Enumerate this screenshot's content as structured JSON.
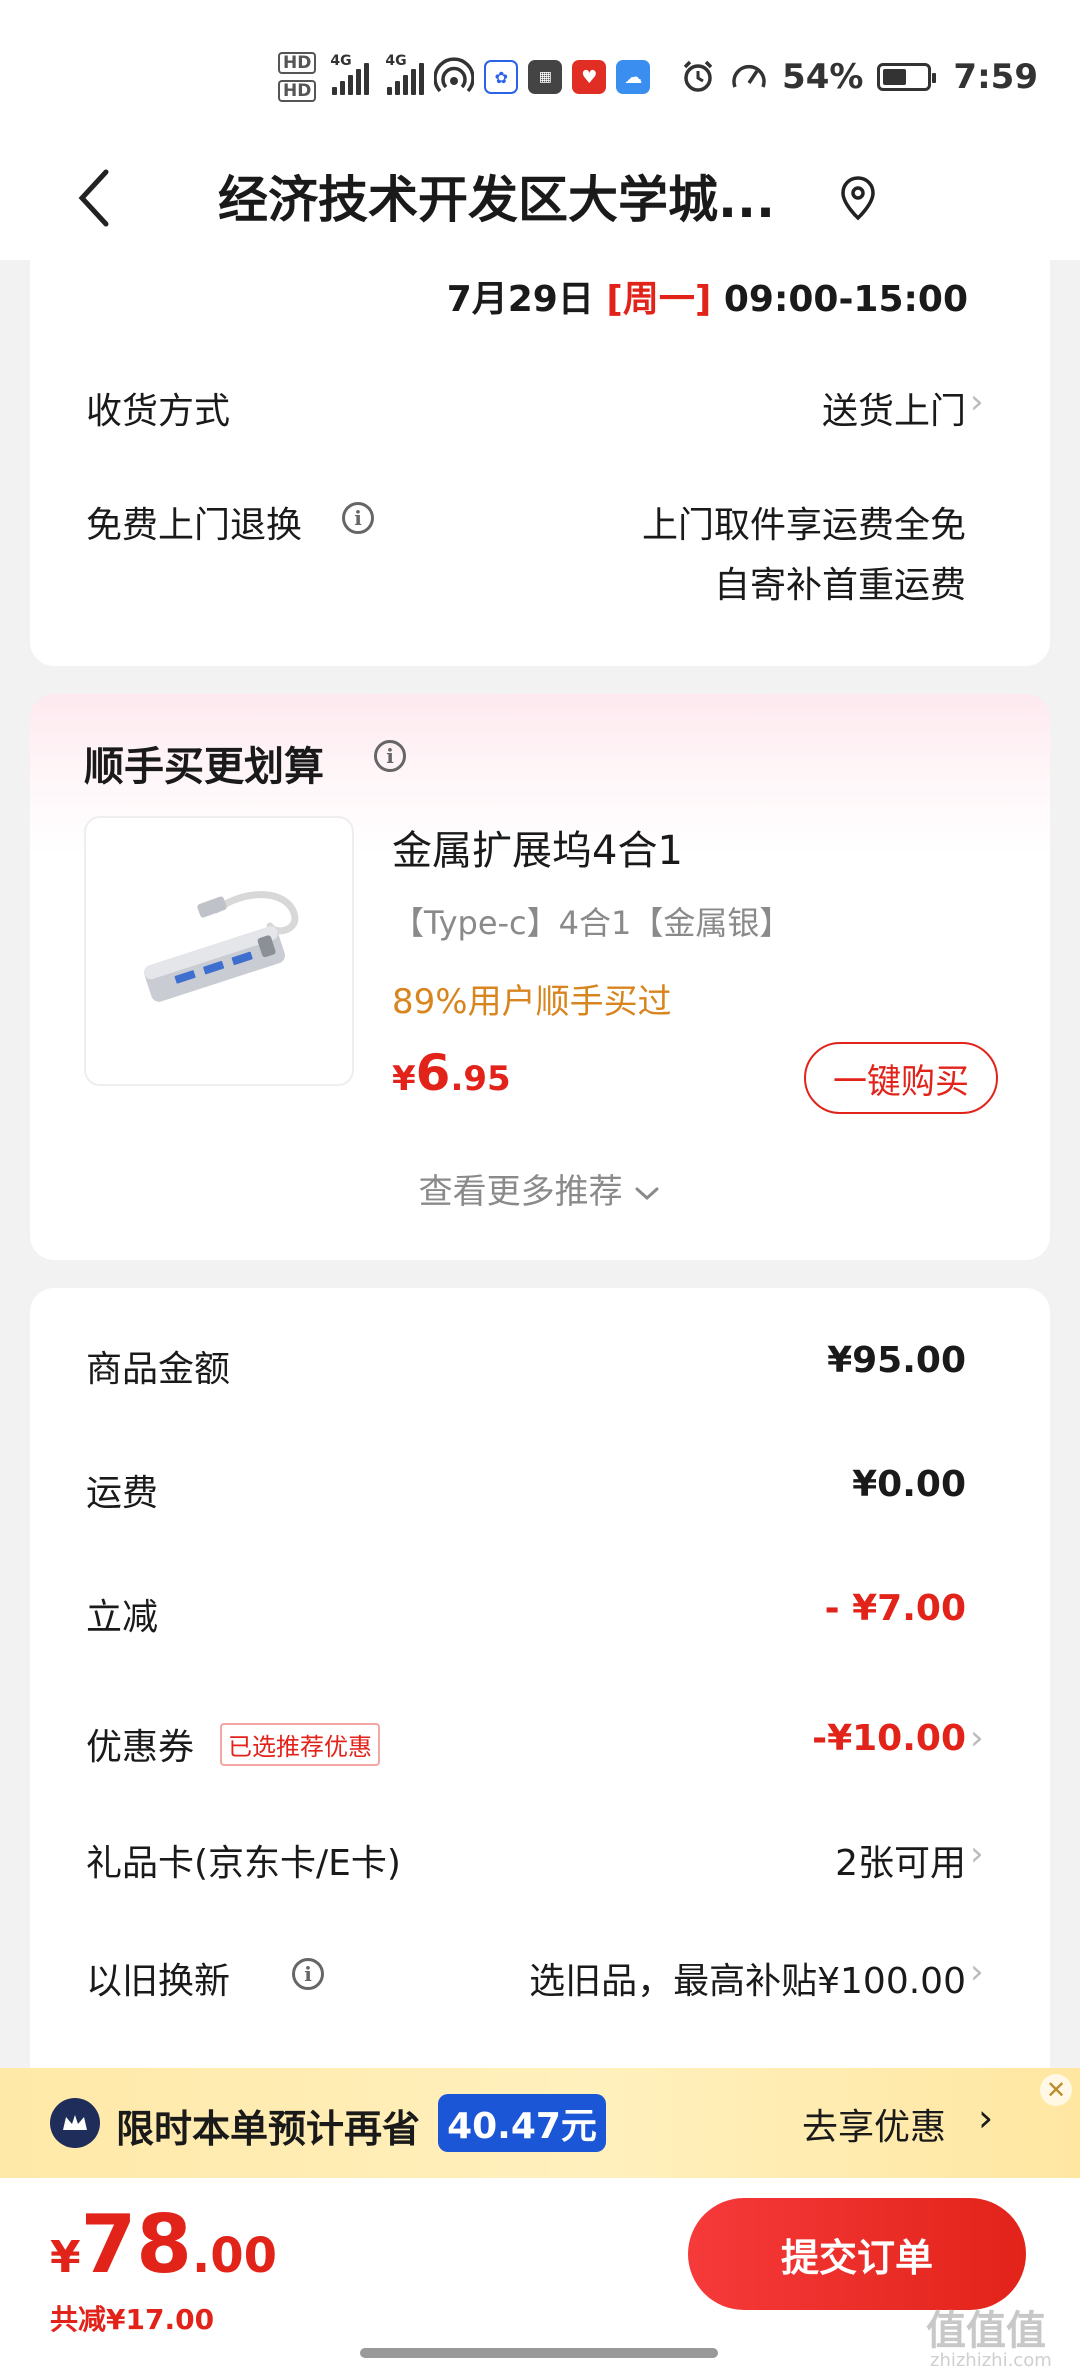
{
  "status_bar": {
    "hd1": "HD",
    "hd2": "HD",
    "net1": "4G",
    "net2": "4G",
    "battery": "54%",
    "time": "7:59"
  },
  "nav": {
    "title": "经济技术开发区大学城..."
  },
  "delivery": {
    "date": "7月29日",
    "weekday": "[周一]",
    "time_range": "09:00-15:00",
    "method_label": "收货方式",
    "method_value": "送货上门",
    "return_label": "免费上门退换",
    "return_line1": "上门取件享运费全免",
    "return_line2": "自寄补首重运费"
  },
  "recommend": {
    "title": "顺手买更划算",
    "product_name": "金属扩展坞4合1",
    "product_spec": "【Type-c】4合1【金属银】",
    "product_stat": "89%用户顺手买过",
    "price_currency": "¥",
    "price_int": "6",
    "price_dec": ".95",
    "buy_label": "一键购买",
    "more_label": "查看更多推荐"
  },
  "summary": {
    "items_label": "商品金额",
    "items_value": "¥95.00",
    "shipping_label": "运费",
    "shipping_value": "¥0.00",
    "discount_label": "立减",
    "discount_value": "- ¥7.00",
    "coupon_label": "优惠券",
    "coupon_tag": "已选推荐优惠",
    "coupon_value": "-¥10.00",
    "giftcard_label": "礼品卡(京东卡/E卡)",
    "giftcard_value": "2张可用",
    "tradein_label": "以旧换新",
    "tradein_value": "选旧品，最高补贴¥100.00"
  },
  "promo": {
    "text": "限时本单预计再省",
    "amount": "40.47元",
    "action": "去享优惠",
    "close": "✕"
  },
  "footer": {
    "price_currency": "¥",
    "price_int": "78",
    "price_dec": ".00",
    "saving": "共减¥17.00",
    "submit_label": "提交订单",
    "watermark": "值值值",
    "watermark_sub": "zhizhizhi.com"
  },
  "colors": {
    "accent_red": "#e2231a",
    "promo_blue": "#1a56d6",
    "stat_orange": "#d9851f"
  }
}
